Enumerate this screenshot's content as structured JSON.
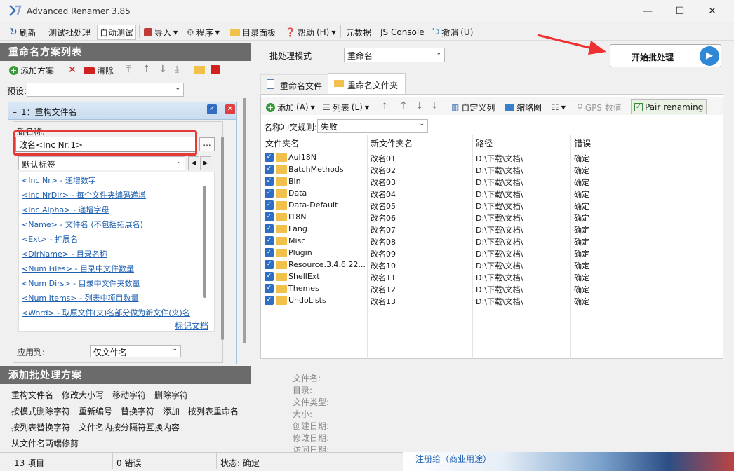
{
  "app": {
    "title": "Advanced Renamer 3.85"
  },
  "toolbar": {
    "refresh": "刷新",
    "test_batch": "测试批处理",
    "auto_test": "自动测试",
    "import": "导入",
    "program": "程序",
    "dir_panel": "目录面板",
    "help": "帮助",
    "help_key": "(H)",
    "metadata": "元数据",
    "js_console": "JS Console",
    "undo": "撤消",
    "undo_key": "(U)"
  },
  "left": {
    "methods_list_title": "重命名方案列表",
    "add_method": "添加方案",
    "clear": "清除",
    "preset_label": "预设:",
    "preset_value": "",
    "rule": {
      "title": "1：重构文件名",
      "newname_label": "新名称:",
      "newname_value": "改名<Inc Nr:1>",
      "browse": "...",
      "tag_select": "默认标签",
      "tags": [
        "<Inc Nr> - 递增数字",
        "<Inc NrDir> - 每个文件夹编码递增",
        "<Inc Alpha> - 递增字母",
        "<Name> - 文件名 (不包括拓展名)",
        "<Ext> - 扩展名",
        "<DirName> - 目录名称",
        "<Num Files> - 目录中文件数量",
        "<Num Dirs> - 目录中文件夹数量",
        "<Num Items> - 列表中项目数量",
        "<Word> - 取原文件(夹)名部分做为新文件(夹)名"
      ],
      "doc_link": "标记文档",
      "applyto_label": "应用到:",
      "applyto_value": "仅文件名"
    },
    "add_methods_title": "添加批处理方案",
    "methods": [
      "重构文件名",
      "修改大小写",
      "移动字符",
      "删除字符",
      "按模式删除字符",
      "重新编号",
      "替换字符",
      "添加",
      "按列表重命名",
      "按列表替换字符",
      "文件名内按分隔符互换内容",
      "从文件名两端修剪"
    ]
  },
  "right": {
    "batch_mode_label": "批处理模式",
    "batch_mode_value": "重命名",
    "start": "开始批处理",
    "tab_files": "重命名文件",
    "tab_folders": "重命名文件夹",
    "list_toolbar": {
      "add": "添加",
      "add_key": "(A)",
      "list": "列表",
      "list_key": "(L)",
      "custom_cols": "自定义列",
      "thumbs": "缩略图",
      "gps": "GPS 数值",
      "pair": "Pair renaming"
    },
    "conflict_label": "名称冲突规则:",
    "conflict_value": "失败",
    "columns": [
      "文件夹名",
      "新文件夹名",
      "路径",
      "错误"
    ],
    "rows": [
      {
        "name": "AuI18N",
        "new": "改名01",
        "path": "D:\\下载\\文档\\",
        "err": "确定"
      },
      {
        "name": "BatchMethods",
        "new": "改名02",
        "path": "D:\\下载\\文档\\",
        "err": "确定"
      },
      {
        "name": "Bin",
        "new": "改名03",
        "path": "D:\\下载\\文档\\",
        "err": "确定"
      },
      {
        "name": "Data",
        "new": "改名04",
        "path": "D:\\下载\\文档\\",
        "err": "确定"
      },
      {
        "name": "Data-Default",
        "new": "改名05",
        "path": "D:\\下载\\文档\\",
        "err": "确定"
      },
      {
        "name": "I18N",
        "new": "改名06",
        "path": "D:\\下载\\文档\\",
        "err": "确定"
      },
      {
        "name": "Lang",
        "new": "改名07",
        "path": "D:\\下载\\文档\\",
        "err": "确定"
      },
      {
        "name": "Misc",
        "new": "改名08",
        "path": "D:\\下载\\文档\\",
        "err": "确定"
      },
      {
        "name": "Plugin",
        "new": "改名09",
        "path": "D:\\下载\\文档\\",
        "err": "确定"
      },
      {
        "name": "Resource.3.4.6.22...",
        "new": "改名10",
        "path": "D:\\下载\\文档\\",
        "err": "确定"
      },
      {
        "name": "ShellExt",
        "new": "改名11",
        "path": "D:\\下载\\文档\\",
        "err": "确定"
      },
      {
        "name": "Themes",
        "new": "改名12",
        "path": "D:\\下载\\文档\\",
        "err": "确定"
      },
      {
        "name": "UndoLists",
        "new": "改名13",
        "path": "D:\\下载\\文档\\",
        "err": "确定"
      }
    ],
    "info": [
      "文件名:",
      "目录:",
      "文件类型:",
      "大小:",
      "创建日期:",
      "修改日期:",
      "访问日期:"
    ]
  },
  "status": {
    "items": "13 项目",
    "errors": "0 错误",
    "state": "状态: 确定",
    "register": "注册给（商业用途）"
  }
}
